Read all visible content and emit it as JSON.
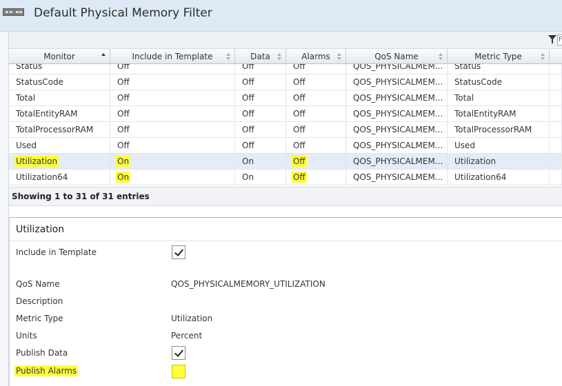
{
  "window": {
    "title": "Default Physical Memory Filter",
    "icon": "memory-module-icon"
  },
  "toolbar": {
    "filter_icon": "filter-icon",
    "filter_input_fragment": "Fi"
  },
  "grid": {
    "columns": [
      {
        "label": "Monitor",
        "sort": "asc"
      },
      {
        "label": "Include in Template",
        "sort": "none"
      },
      {
        "label": "Data",
        "sort": "none"
      },
      {
        "label": "Alarms",
        "sort": "none"
      },
      {
        "label": "QoS Name",
        "sort": "none"
      },
      {
        "label": "Metric Type",
        "sort": "none"
      }
    ],
    "rows": [
      {
        "monitor": "Status",
        "include": "Off",
        "data": "Off",
        "alarms": "Off",
        "qos": "QOS_PHYSICALMEM...",
        "metric": "Status"
      },
      {
        "monitor": "StatusCode",
        "include": "Off",
        "data": "Off",
        "alarms": "Off",
        "qos": "QOS_PHYSICALMEM...",
        "metric": "StatusCode"
      },
      {
        "monitor": "Total",
        "include": "Off",
        "data": "Off",
        "alarms": "Off",
        "qos": "QOS_PHYSICALMEM...",
        "metric": "Total"
      },
      {
        "monitor": "TotalEntityRAM",
        "include": "Off",
        "data": "Off",
        "alarms": "Off",
        "qos": "QOS_PHYSICALMEM...",
        "metric": "TotalEntityRAM"
      },
      {
        "monitor": "TotalProcessorRAM",
        "include": "Off",
        "data": "Off",
        "alarms": "Off",
        "qos": "QOS_PHYSICALMEM...",
        "metric": "TotalProcessorRAM"
      },
      {
        "monitor": "Used",
        "include": "Off",
        "data": "Off",
        "alarms": "Off",
        "qos": "QOS_PHYSICALMEM...",
        "metric": "Used"
      },
      {
        "monitor": "Utilization",
        "include": "On",
        "data": "On",
        "alarms": "Off",
        "qos": "QOS_PHYSICALMEM...",
        "metric": "Utilization",
        "selected": true,
        "highlight": [
          "monitor",
          "include",
          "alarms"
        ]
      },
      {
        "monitor": "Utilization64",
        "include": "On",
        "data": "On",
        "alarms": "Off",
        "qos": "QOS_PHYSICALMEM...",
        "metric": "Utilization64",
        "highlight": [
          "include",
          "alarms"
        ]
      }
    ],
    "status": "Showing 1 to 31 of 31 entries"
  },
  "detail": {
    "title": "Utilization",
    "fields": [
      {
        "label": "Include in Template",
        "type": "checkbox",
        "checked": true
      },
      {
        "label": "QoS Name",
        "type": "text",
        "value": "QOS_PHYSICALMEMORY_UTILIZATION"
      },
      {
        "label": "Description",
        "type": "text",
        "value": ""
      },
      {
        "label": "Metric Type",
        "type": "text",
        "value": "Utilization"
      },
      {
        "label": "Units",
        "type": "text",
        "value": "Percent"
      },
      {
        "label": "Publish Data",
        "type": "checkbox",
        "checked": true
      },
      {
        "label": "Publish Alarms",
        "type": "checkbox",
        "checked": false,
        "highlight": true
      }
    ]
  },
  "colors": {
    "highlight": "#ffff3a",
    "selected_row": "#e3ecf7",
    "titlebar": "#dde9f5"
  }
}
